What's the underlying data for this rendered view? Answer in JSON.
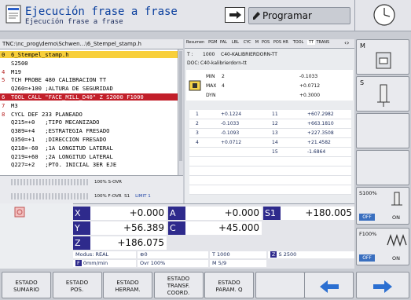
{
  "header": {
    "title": "Ejecución frase a frase",
    "subtitle": "Ejecución frase a frase",
    "programming_label": "Programar"
  },
  "program": {
    "path": "TNC:\\nc_prog\\demo\\Schwen…\\6_Stempel_stamp.h",
    "lines": [
      {
        "num": "0",
        "text": "6_Stempel_stamp.h",
        "style": "hl"
      },
      {
        "num": "",
        "text": "S2500",
        "style": ""
      },
      {
        "num": "4",
        "text": "M19",
        "style": ""
      },
      {
        "num": "5",
        "text": "TCH PROBE 480 CALIBRACION TT",
        "style": ""
      },
      {
        "num": "",
        "text": "Q260=+100 ;ALTURA DE SEGURIDAD",
        "style": ""
      },
      {
        "num": "6",
        "text": "TOOL CALL \"FACE_MILL_D40\" Z S2000 F1000",
        "style": "sel"
      },
      {
        "num": "7",
        "text": "M3",
        "style": ""
      },
      {
        "num": "8",
        "text": "CYCL DEF 233 PLANEADO",
        "style": ""
      },
      {
        "num": "",
        "text": "Q215=+0   ;TIPO MECANIZADO",
        "style": ""
      },
      {
        "num": "",
        "text": "Q389=+4   ;ESTRATEGIA FRESADO",
        "style": ""
      },
      {
        "num": "",
        "text": "Q350=+1   ;DIRECCION FRESADO",
        "style": ""
      },
      {
        "num": "",
        "text": "Q218=-60  ;1A LONGITUD LATERAL",
        "style": ""
      },
      {
        "num": "",
        "text": "Q219=+60  ;2A LONGITUD LATERAL",
        "style": ""
      },
      {
        "num": "",
        "text": "Q227=+2   ;PTO. INICIAL 3ER EJE",
        "style": ""
      }
    ],
    "override_s": "100% S-OVR",
    "override_f": "100% F-OVR",
    "override_f_extra": "S1",
    "override_limit": "LIMIT 1"
  },
  "status": {
    "tabs": [
      "Resumen",
      "PGM",
      "PAL",
      "LBL",
      "CYC",
      "M",
      "POS",
      "POS HR",
      "TOOL",
      "TT",
      "TRANS"
    ],
    "active_tab": "TT",
    "t_label": "T :",
    "t_value": "1000",
    "t_name": "C40-KALIBRIERDORN-TT",
    "doc_label": "DOC:",
    "doc_value": "C40-kalibrierdorn-tt",
    "min_label": "MIN",
    "min_value": "2",
    "min_meas": "-0.1033",
    "max_label": "MAX",
    "max_value": "4",
    "max_meas": "+0.0712",
    "dyn_label": "DYN",
    "dyn_meas": "+0.3000",
    "table": [
      [
        "1",
        "+0.1224",
        "11",
        "+607.2982"
      ],
      [
        "2",
        "-0.1033",
        "12",
        "+663.1810"
      ],
      [
        "3",
        "-0.1093",
        "13",
        "+227.3508"
      ],
      [
        "4",
        "+0.0712",
        "14",
        "+21.4582"
      ],
      [
        "",
        "",
        "15",
        "-1.6864"
      ]
    ]
  },
  "position": {
    "axes": [
      {
        "label": "X",
        "value": "+0.000"
      },
      {
        "label": "A",
        "value": "+0.000"
      },
      {
        "label": "S1",
        "value": "+180.005"
      },
      {
        "label": "Y",
        "value": "+56.389"
      },
      {
        "label": "C",
        "value": "+45.000"
      },
      {
        "label": "Z",
        "value": "+186.075"
      }
    ],
    "mode": "Modus: REAL",
    "datum": "0",
    "feed": "0mm/min",
    "ovr": "Ovr 100%",
    "tool": "T 1000",
    "spindle": "S 2500",
    "m": "M 5/9",
    "spindle_letter": "Z"
  },
  "right_softkeys": {
    "m_label": "M",
    "s_label": "S",
    "s_ovr": "S100%",
    "f_ovr": "F100%",
    "off": "OFF",
    "on": "ON"
  },
  "bottom_softkeys": [
    {
      "line1": "ESTADO",
      "line2": "SUMARIO",
      "line3": ""
    },
    {
      "line1": "ESTADO",
      "line2": "POS.",
      "line3": ""
    },
    {
      "line1": "ESTADO",
      "line2": "HERRAM.",
      "line3": ""
    },
    {
      "line1": "ESTADO",
      "line2": "TRANSF.",
      "line3": "COORD."
    },
    {
      "line1": "ESTADO",
      "line2": "PARAM. Q",
      "line3": ""
    },
    {
      "line1": "",
      "line2": "",
      "line3": ""
    }
  ],
  "colors": {
    "header_title": "#0a3f9e",
    "axis_label_bg": "#2e2a8c",
    "selected_line": "#c21f2a",
    "program_highlight": "#f8cf3a",
    "off_button": "#3a6fbf"
  }
}
